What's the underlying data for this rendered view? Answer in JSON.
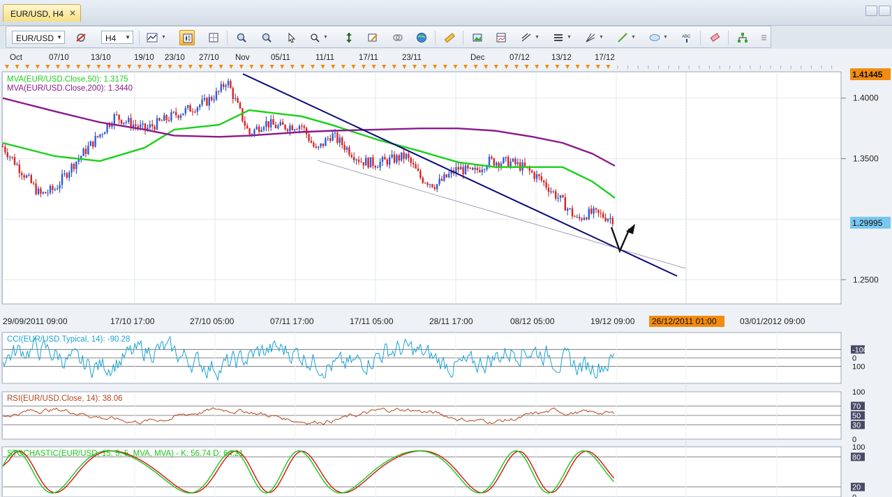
{
  "tab": {
    "label": "EUR/USD, H4",
    "close": "✕"
  },
  "toolbar": {
    "symbol": "EUR/USD",
    "period": "H4"
  },
  "top_dates": [
    "Oct",
    "07/10",
    "13/10",
    "19/10",
    "23/10",
    "27/10",
    "Nov",
    "05/11",
    "11/11",
    "17/11",
    "23/11",
    "Dec",
    "07/12",
    "13/12",
    "17/12"
  ],
  "bottom_dates": [
    "29/09/2011 09:00",
    "17/10 17:00",
    "27/10 05:00",
    "07/11 17:00",
    "17/11 05:00",
    "28/11 17:00",
    "08/12 05:00",
    "19/12 09:00",
    "26/12/2011 01:00",
    "03/01/2012 09:00"
  ],
  "colors": {
    "accent": "#f28c0f",
    "ma50": "#19d119",
    "ma200": "#8a1a8a",
    "trend": "#0a0a7a",
    "cci": "#1aa3d6",
    "rsi": "#b5451b",
    "stoch_k": "#17c617",
    "stoch_d": "#d11212",
    "last_price_bg": "#79c7f0"
  },
  "chart_data": [
    {
      "type": "line",
      "title": "",
      "series": [
        {
          "name": "MVA(EUR/USD.Close,50): 1.3175",
          "color": "#19d119",
          "x": [
            "29/09",
            "05/10",
            "11/10",
            "17/10",
            "21/10",
            "27/10",
            "31/10",
            "07/11",
            "11/11",
            "17/11",
            "23/11",
            "28/11",
            "03/12",
            "08/12",
            "12/12",
            "16/12",
            "19/12"
          ],
          "values": [
            1.363,
            1.352,
            1.348,
            1.359,
            1.374,
            1.378,
            1.39,
            1.385,
            1.378,
            1.366,
            1.356,
            1.347,
            1.343,
            1.343,
            1.343,
            1.331,
            1.3175
          ]
        },
        {
          "name": "MVA(EUR/USD.Close,200): 1.3440",
          "color": "#8a1a8a",
          "x": [
            "29/09",
            "05/10",
            "11/10",
            "17/10",
            "21/10",
            "27/10",
            "31/10",
            "07/11",
            "11/11",
            "17/11",
            "23/11",
            "28/11",
            "03/12",
            "08/12",
            "12/12",
            "16/12",
            "19/12"
          ],
          "values": [
            1.4,
            1.389,
            1.38,
            1.374,
            1.369,
            1.368,
            1.369,
            1.372,
            1.373,
            1.374,
            1.375,
            1.375,
            1.373,
            1.368,
            1.363,
            1.354,
            1.344
          ]
        }
      ],
      "price": {
        "x": [
          "29/09",
          "03/10",
          "05/10",
          "07/10",
          "11/10",
          "13/10",
          "17/10",
          "19/10",
          "21/10",
          "25/10",
          "27/10",
          "28/10",
          "31/10",
          "02/11",
          "04/11",
          "07/11",
          "09/11",
          "11/11",
          "15/11",
          "17/11",
          "21/11",
          "23/11",
          "25/11",
          "28/11",
          "30/11",
          "02/12",
          "05/12",
          "07/12",
          "09/12",
          "12/12",
          "14/12",
          "15/12",
          "16/12",
          "19/12"
        ],
        "close": [
          1.36,
          1.32,
          1.325,
          1.342,
          1.37,
          1.385,
          1.374,
          1.38,
          1.386,
          1.396,
          1.405,
          1.415,
          1.37,
          1.38,
          1.376,
          1.378,
          1.356,
          1.37,
          1.348,
          1.346,
          1.352,
          1.334,
          1.328,
          1.342,
          1.338,
          1.348,
          1.347,
          1.342,
          1.333,
          1.314,
          1.299,
          1.304,
          1.305,
          1.2999
        ]
      },
      "last_price": "1.29995",
      "top_price": "1.41445",
      "yticks": [
        "1.4000",
        "1.3500",
        "1.2500"
      ],
      "ylim": [
        1.23,
        1.42
      ],
      "grid": true
    },
    {
      "type": "line",
      "title": "CCI(EUR/USD.Typical, 14): -90.28",
      "ticks": [
        "100",
        "0",
        "-100"
      ],
      "ylim": [
        -300,
        300
      ],
      "grid": true
    },
    {
      "type": "line",
      "title": "RSI(EUR/USD.Close, 14): 38.06",
      "ticks": [
        "100",
        "70",
        "50",
        "30",
        "0"
      ],
      "ylim": [
        0,
        100
      ],
      "grid": true
    },
    {
      "type": "line",
      "title": "STOCHASTIC(EUR/USD, 15, 5, 5, MVA, MVA) -  K: 56.74  D: 64.21",
      "ticks": [
        "100",
        "80",
        "20",
        "0"
      ],
      "ylim": [
        0,
        100
      ],
      "grid": true
    }
  ]
}
